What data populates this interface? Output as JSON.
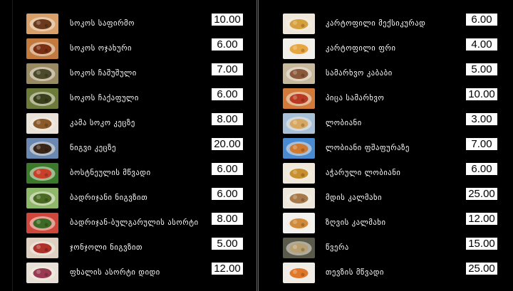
{
  "menu": {
    "left": [
      {
        "name": "სოკოს საფირმო",
        "price": "10.00",
        "icon": "food-photo",
        "plate": "#d9a06a",
        "food": "#6b3a1c"
      },
      {
        "name": "სოკოს ოჯახური",
        "price": "6.00",
        "icon": "food-photo",
        "plate": "#c27a3e",
        "food": "#7a2f12"
      },
      {
        "name": "სოკოს ჩაშუშული",
        "price": "7.00",
        "icon": "food-photo",
        "plate": "#9a8a62",
        "food": "#4d4a2b"
      },
      {
        "name": "სოკოს ჩაქაფული",
        "price": "6.00",
        "icon": "food-photo",
        "plate": "#6c7a3a",
        "food": "#3a3f1c"
      },
      {
        "name": "კამა სოკო კეცზე",
        "price": "8.00",
        "icon": "food-photo",
        "plate": "#e8e2d8",
        "food": "#8a5a2a"
      },
      {
        "name": "ნიგვი კეცზე",
        "price": "20.00",
        "icon": "food-photo",
        "plate": "#6a88b0",
        "food": "#3a2616"
      },
      {
        "name": "ბოსტნეულის მწვადი",
        "price": "6.00",
        "icon": "food-photo",
        "plate": "#3b7a2a",
        "food": "#c9402a"
      },
      {
        "name": "ბადრიჯანი ნიგვზით",
        "price": "6.00",
        "icon": "food-photo",
        "plate": "#8fb86a",
        "food": "#4a6a22"
      },
      {
        "name": "ბადრიჯან-ბულგარულის ასორტი",
        "price": "8.00",
        "icon": "food-photo",
        "plate": "#d0463a",
        "food": "#3c6a24"
      },
      {
        "name": "ჯონჯოლი ნიგვზით",
        "price": "5.00",
        "icon": "food-photo",
        "plate": "#e0d0c2",
        "food": "#b0302a"
      },
      {
        "name": "ფხალის ასორტი დიდი",
        "price": "12.00",
        "icon": "food-photo",
        "plate": "#e8e0d6",
        "food": "#9a3a52"
      }
    ],
    "right": [
      {
        "name": "კარტოფილი მექსიკურად",
        "price": "6.00",
        "icon": "food-photo",
        "plate": "#efe8da",
        "food": "#d6a03c"
      },
      {
        "name": "კარტოფილი ფრი",
        "price": "4.00",
        "icon": "food-photo",
        "plate": "#f2f0ea",
        "food": "#e6a640"
      },
      {
        "name": "სამარხვო კაბაბი",
        "price": "5.00",
        "icon": "food-photo",
        "plate": "#c8b89e",
        "food": "#8a5a3a"
      },
      {
        "name": "პიცა სამარხვო",
        "price": "10.00",
        "icon": "food-photo",
        "plate": "#d27a3a",
        "food": "#b83a22"
      },
      {
        "name": "ლობიანი",
        "price": "3.00",
        "icon": "food-photo",
        "plate": "#a8c0d8",
        "food": "#d8a860"
      },
      {
        "name": "ლობიანი ფშაფურაზე",
        "price": "7.00",
        "icon": "food-photo",
        "plate": "#4a8ad0",
        "food": "#d07a30"
      },
      {
        "name": "აჭარული ლობიანი",
        "price": "6.00",
        "icon": "food-photo",
        "plate": "#f0e8d8",
        "food": "#c8902e"
      },
      {
        "name": "მდის კალმახი",
        "price": "25.00",
        "icon": "food-photo",
        "plate": "#eee8dc",
        "food": "#a87a4a"
      },
      {
        "name": "ზღვის კალმახი",
        "price": "12.00",
        "icon": "food-photo",
        "plate": "#f4f2ee",
        "food": "#d08a3a"
      },
      {
        "name": "წვერა",
        "price": "15.00",
        "icon": "food-photo",
        "plate": "#5a5a4a",
        "food": "#b8a070"
      },
      {
        "name": "თევზის მწვადი",
        "price": "25.00",
        "icon": "food-photo",
        "plate": "#f0ece6",
        "food": "#e0782a"
      }
    ]
  }
}
